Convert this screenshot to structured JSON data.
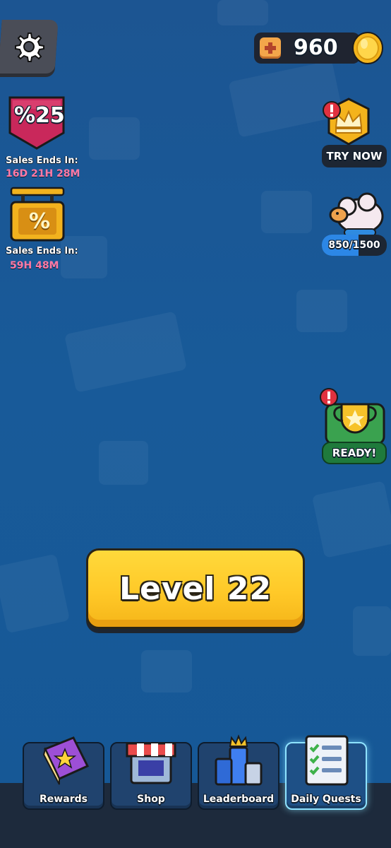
{
  "header": {
    "settings_icon": "gear-icon",
    "coins": "960",
    "coin_icon": "gold-coin-icon",
    "add_icon": "plus-icon"
  },
  "sales": [
    {
      "badge_text": "%25",
      "label": "Sales Ends In:",
      "time": "16D 21H 28M",
      "icon": "discount-ribbon-icon"
    },
    {
      "badge_text": "%",
      "label": "Sales Ends In:",
      "time": "59H 48M",
      "icon": "shop-sign-icon"
    }
  ],
  "side_widgets": {
    "vip": {
      "label": "TRY NOW",
      "icon": "crown-icon",
      "alert": "!"
    },
    "piggy": {
      "progress_text": "850/1500",
      "current": 850,
      "max": 1500,
      "icon": "sheep-piggybank-icon"
    },
    "trophy": {
      "label": "READY!",
      "icon": "trophy-icon",
      "alert": "!"
    }
  },
  "level_button": {
    "label": "Level 22"
  },
  "nav": [
    {
      "label": "Rewards",
      "icon": "book-icon",
      "active": false
    },
    {
      "label": "Shop",
      "icon": "shop-icon",
      "active": false
    },
    {
      "label": "Leaderboard",
      "icon": "leaderboard-icon",
      "active": false
    },
    {
      "label": "Daily Quests",
      "icon": "checklist-icon",
      "active": true
    }
  ],
  "colors": {
    "background": "#185a99",
    "accent_yellow": "#ffc928",
    "sale_time_pink": "#ff7aa6",
    "active_outline": "#8fe3ff"
  }
}
